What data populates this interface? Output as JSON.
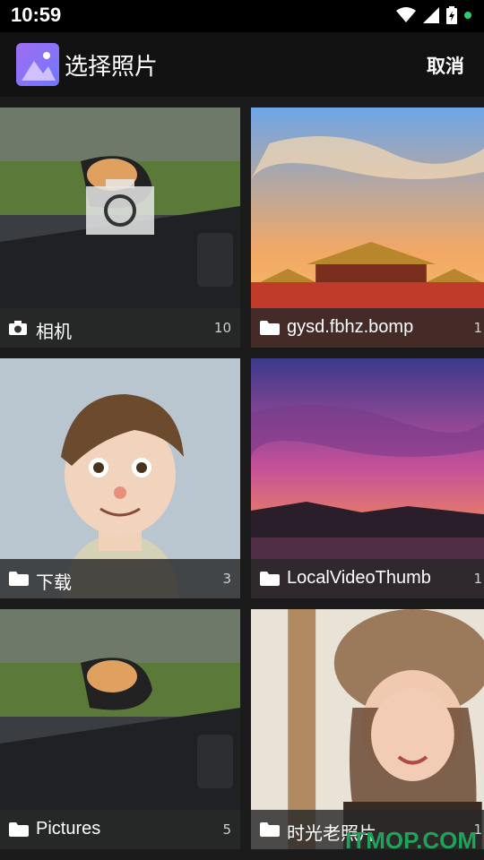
{
  "status_bar": {
    "time": "10:59"
  },
  "header": {
    "title": "选择照片",
    "cancel_label": "取消"
  },
  "albums": [
    {
      "name": "相机",
      "count": "10",
      "icon": "camera-icon"
    },
    {
      "name": "gysd.fbhz.bomp",
      "count": "1",
      "icon": "folder-icon"
    },
    {
      "name": "下载",
      "count": "3",
      "icon": "folder-icon"
    },
    {
      "name": "LocalVideoThumb",
      "count": "1",
      "icon": "folder-icon"
    },
    {
      "name": "Pictures",
      "count": "5",
      "icon": "folder-icon"
    },
    {
      "name": "时光老照片",
      "count": "1",
      "icon": "folder-icon"
    }
  ],
  "watermark": "ITMOP.COM",
  "colors": {
    "accent": "#7b6ff0",
    "watermark": "#1fa25a"
  }
}
